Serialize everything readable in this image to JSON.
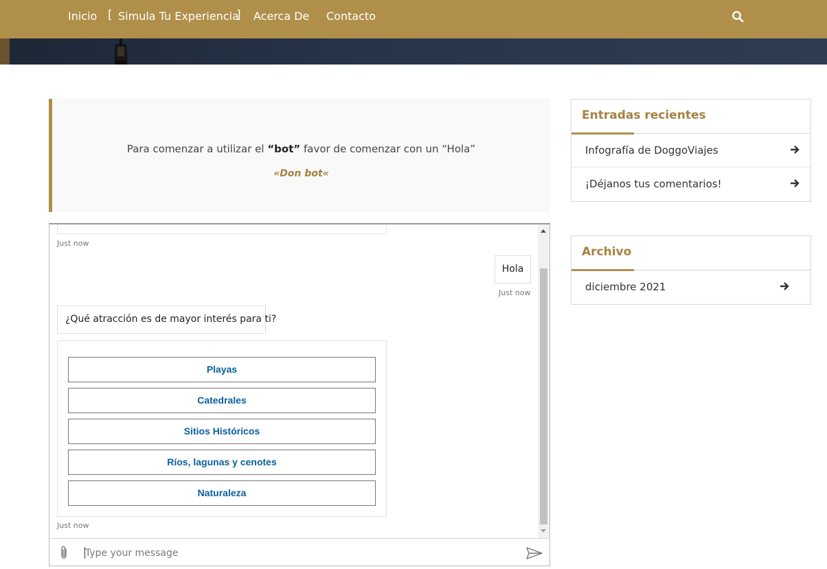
{
  "nav": {
    "items": [
      "Inicio",
      "Simula Tu Experiencia",
      "Acerca De",
      "Contacto"
    ],
    "active_open_bracket": "[",
    "active_close_bracket": "]",
    "search_icon": "search-icon"
  },
  "intro": {
    "text_before": "Para comenzar a utilizar el ",
    "text_bold": "“bot”",
    "text_after": " favor de comenzar con un “Hola”",
    "cite": "«Don bot«"
  },
  "chat": {
    "messages": [
      {
        "from": "bot",
        "timestamp": "Just now"
      },
      {
        "from": "user",
        "text": "Hola",
        "timestamp": "Just now"
      },
      {
        "from": "bot",
        "text": "¿Qué atracción es de mayor interés para ti?"
      }
    ],
    "choices": [
      "Playas",
      "Catedrales",
      "Sitios Históricos",
      "Ríos, lagunas y cenotes",
      "Naturaleza"
    ],
    "choices_timestamp": "Just now",
    "input_placeholder": "Type your message",
    "attach_icon": "paperclip-icon",
    "send_icon": "send-icon"
  },
  "sidebar": {
    "recent": {
      "title": "Entradas recientes",
      "items": [
        "Infografía de DoggoViajes",
        "¡Déjanos tus comentarios!"
      ]
    },
    "archive": {
      "title": "Archivo",
      "items": [
        "diciembre 2021"
      ]
    }
  },
  "colors": {
    "brand": "#b08f4a",
    "link_blue": "#0a5fa0"
  }
}
